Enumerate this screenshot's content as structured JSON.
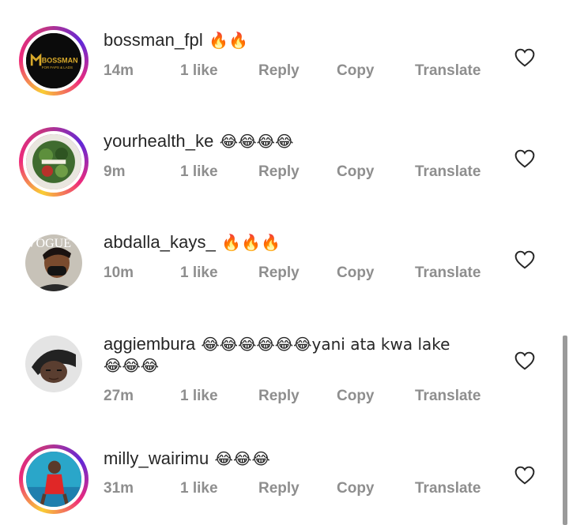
{
  "comments": [
    {
      "username": "bossman_fpl",
      "text": "🔥🔥",
      "text2": "",
      "time": "14m",
      "likes": "1 like",
      "reply": "Reply",
      "copy": "Copy",
      "translate": "Translate",
      "avatar_text": "BOSSMAN",
      "avatar_subtext": "FOR FAPS & LADS"
    },
    {
      "username": "yourhealth_ke",
      "text": "😂😂😂😂",
      "text2": "",
      "time": "9m",
      "likes": "1 like",
      "reply": "Reply",
      "copy": "Copy",
      "translate": "Translate"
    },
    {
      "username": "abdalla_kays_",
      "text": "🔥🔥🔥",
      "text2": "",
      "time": "10m",
      "likes": "1 like",
      "reply": "Reply",
      "copy": "Copy",
      "translate": "Translate",
      "avatar_text": "VOGUE"
    },
    {
      "username": "aggiembura",
      "text": "😂😂😂😂😂😂yani ata kwa lake",
      "text2": "😂😂😂",
      "time": "27m",
      "likes": "1 like",
      "reply": "Reply",
      "copy": "Copy",
      "translate": "Translate"
    },
    {
      "username": "milly_wairimu",
      "text": "😂😂😂",
      "text2": "",
      "time": "31m",
      "likes": "1 like",
      "reply": "Reply",
      "copy": "Copy",
      "translate": "Translate"
    }
  ],
  "icons": {
    "like": "heart-outline-icon"
  },
  "colors": {
    "meta": "#8e8e8e",
    "username": "#262626"
  }
}
